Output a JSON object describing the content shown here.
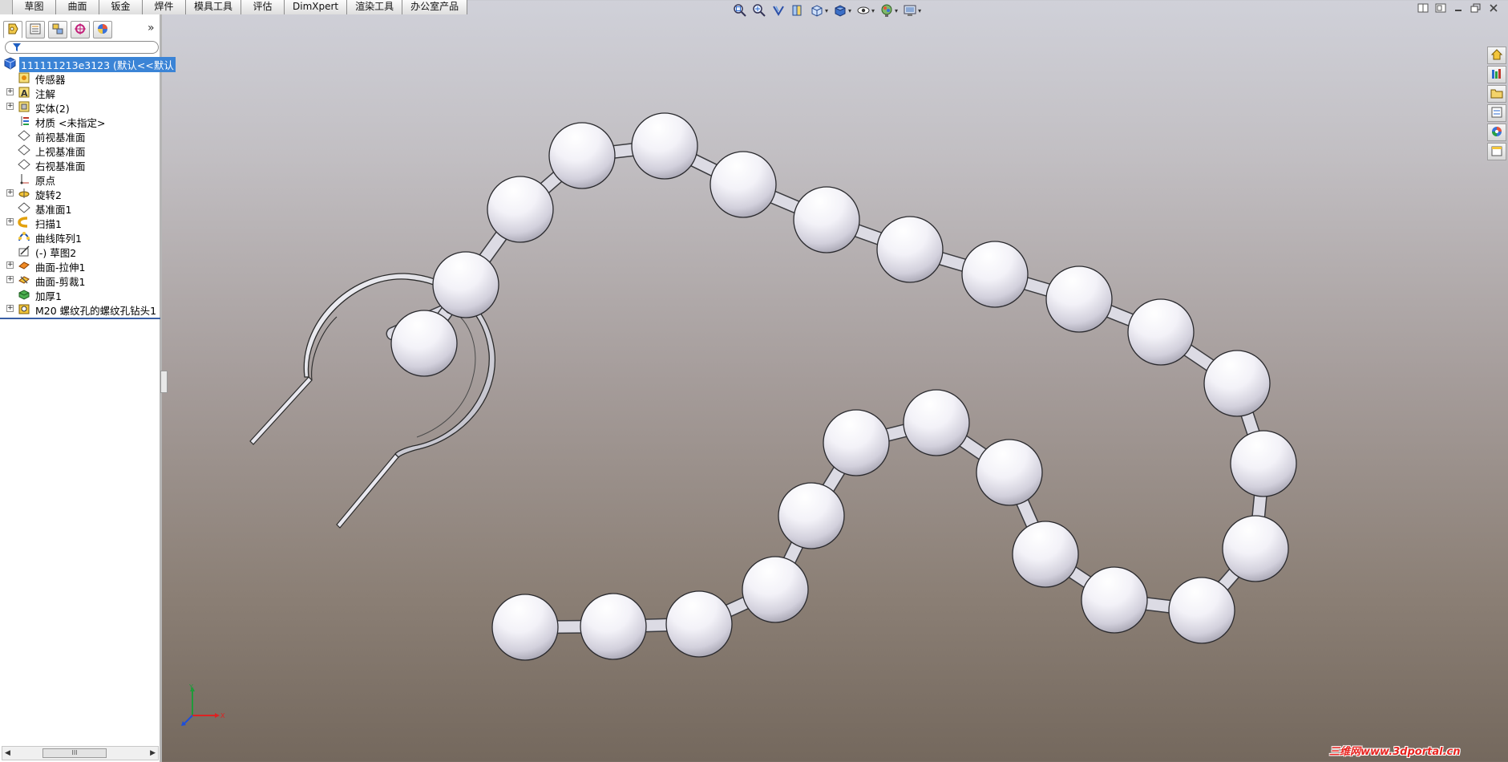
{
  "command_tabs": [
    "草图",
    "曲面",
    "钣金",
    "焊件",
    "模具工具",
    "评估",
    "DimXpert",
    "渲染工具",
    "办公室产品"
  ],
  "view_toolbar": [
    {
      "icon": "zoom-to-fit-icon",
      "dropdown": false
    },
    {
      "icon": "zoom-to-area-icon",
      "dropdown": false
    },
    {
      "icon": "previous-view-icon",
      "dropdown": false
    },
    {
      "icon": "section-view-icon",
      "dropdown": false
    },
    {
      "icon": "view-orientation-icon",
      "dropdown": true
    },
    {
      "icon": "display-style-icon",
      "dropdown": true
    },
    {
      "icon": "hide-show-items-icon",
      "dropdown": true
    },
    {
      "icon": "edit-appearance-icon",
      "dropdown": true
    },
    {
      "icon": "apply-scene-icon",
      "dropdown": true
    }
  ],
  "feature_panel": {
    "tabs": [
      "featuremanager-tab-icon",
      "propertymanager-tab-icon",
      "configurationmanager-tab-icon",
      "dimxpertmanager-tab-icon",
      "displaymanager-tab-icon"
    ],
    "more_label": "»",
    "root_label": "111111213e3123 (默认<<默认",
    "items": [
      {
        "label": "传感器",
        "icon": "sensor-icon",
        "expandable": false
      },
      {
        "label": "注解",
        "icon": "annotation-icon",
        "expandable": true
      },
      {
        "label": "实体(2)",
        "icon": "solid-bodies-icon",
        "expandable": true
      },
      {
        "label": "材质 <未指定>",
        "icon": "material-icon",
        "expandable": false
      },
      {
        "label": "前视基准面",
        "icon": "plane-icon",
        "expandable": false
      },
      {
        "label": "上视基准面",
        "icon": "plane-icon",
        "expandable": false
      },
      {
        "label": "右视基准面",
        "icon": "plane-icon",
        "expandable": false
      },
      {
        "label": "原点",
        "icon": "origin-icon",
        "expandable": false
      },
      {
        "label": "旋转2",
        "icon": "revolve-icon",
        "expandable": true
      },
      {
        "label": "基准面1",
        "icon": "plane-icon",
        "expandable": false
      },
      {
        "label": "扫描1",
        "icon": "sweep-icon",
        "expandable": true
      },
      {
        "label": "曲线阵列1",
        "icon": "curve-pattern-icon",
        "expandable": false
      },
      {
        "label": "(-) 草图2",
        "icon": "sketch-icon",
        "expandable": false
      },
      {
        "label": "曲面-拉伸1",
        "icon": "surface-extrude-icon",
        "expandable": true
      },
      {
        "label": "曲面-剪裁1",
        "icon": "surface-trim-icon",
        "expandable": true
      },
      {
        "label": "加厚1",
        "icon": "thicken-icon",
        "expandable": false
      },
      {
        "label": "M20 螺纹孔的螺纹孔钻头1",
        "icon": "hole-wizard-icon",
        "expandable": true
      }
    ],
    "scroll_thumb": "III"
  },
  "task_pane_buttons": [
    "solidworks-resources-icon",
    "design-library-icon",
    "file-explorer-icon",
    "view-palette-icon",
    "appearances-icon",
    "custom-properties-icon"
  ],
  "triad_labels": {
    "x": "X",
    "y": "Y"
  },
  "watermark": "三维网www.3dportal.cn",
  "colors": {
    "selection": "#3b84d6",
    "watermark": "#e8231f",
    "viewport_top": "#d0d1d9",
    "viewport_bottom": "#74685d"
  }
}
